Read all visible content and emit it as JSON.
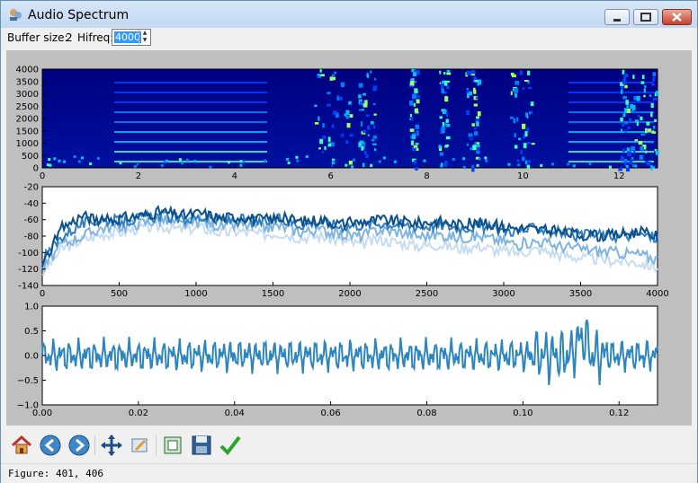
{
  "window": {
    "title": "Audio Spectrum",
    "controls": [
      "minimize",
      "maximize",
      "close"
    ]
  },
  "controls_bar": {
    "buffer_label": "Buffer size:",
    "buffer_value": "2",
    "hifreq_label": "Hifreq:",
    "hifreq_value": "4000"
  },
  "chart_data": [
    {
      "type": "heatmap",
      "title": "",
      "x_ticks": [
        "0",
        "2",
        "4",
        "6",
        "8",
        "10",
        "12"
      ],
      "y_ticks": [
        "4000",
        "3500",
        "3000",
        "2500",
        "2000",
        "1500",
        "1000",
        "500",
        "0"
      ],
      "xlim": [
        0,
        12.8
      ],
      "ylim": [
        0,
        4000
      ],
      "colormap": "jet"
    },
    {
      "type": "line",
      "x_ticks": [
        "0",
        "500",
        "1000",
        "1500",
        "2000",
        "2500",
        "3000",
        "3500",
        "4000"
      ],
      "y_ticks": [
        "-20",
        "-40",
        "-60",
        "-80",
        "-100",
        "-120",
        "-140"
      ],
      "xlim": [
        0,
        4000
      ],
      "ylim": [
        -140,
        -20
      ],
      "series": [
        {
          "color": "#0b4f8c",
          "values": [
            -115,
            -70,
            -55,
            -62,
            -58,
            -55,
            -50,
            -55,
            -52,
            -58,
            -56,
            -60,
            -58,
            -62,
            -60,
            -65,
            -63,
            -60,
            -62,
            -64,
            -62,
            -66,
            -64,
            -68,
            -70,
            -72,
            -75,
            -78,
            -80,
            -78,
            -75,
            -80
          ]
        },
        {
          "color": "#2f7fbf",
          "values": [
            -110,
            -80,
            -65,
            -60,
            -62,
            -58,
            -55,
            -60,
            -57,
            -62,
            -60,
            -64,
            -60,
            -66,
            -62,
            -68,
            -66,
            -64,
            -66,
            -68,
            -66,
            -70,
            -68,
            -72,
            -74,
            -70,
            -75,
            -80,
            -78,
            -80,
            -78,
            -82
          ]
        },
        {
          "color": "#7fb3e0",
          "values": [
            -120,
            -90,
            -80,
            -70,
            -68,
            -64,
            -60,
            -66,
            -62,
            -68,
            -66,
            -70,
            -68,
            -75,
            -72,
            -78,
            -80,
            -72,
            -75,
            -80,
            -78,
            -82,
            -80,
            -85,
            -90,
            -86,
            -92,
            -95,
            -98,
            -100,
            -102,
            -108
          ]
        },
        {
          "color": "#c6dcf0",
          "values": [
            -125,
            -95,
            -85,
            -78,
            -75,
            -70,
            -68,
            -72,
            -70,
            -76,
            -74,
            -78,
            -76,
            -82,
            -80,
            -86,
            -90,
            -84,
            -88,
            -92,
            -90,
            -95,
            -92,
            -98,
            -100,
            -96,
            -102,
            -106,
            -108,
            -110,
            -112,
            -118
          ]
        }
      ]
    },
    {
      "type": "line",
      "x_ticks": [
        "0.00",
        "0.02",
        "0.04",
        "0.06",
        "0.08",
        "0.10",
        "0.12"
      ],
      "y_ticks": [
        "1.0",
        "0.5",
        "0.0",
        "−0.5",
        "−1.0"
      ],
      "xlim": [
        0,
        0.128
      ],
      "ylim": [
        -1,
        1
      ],
      "series": [
        {
          "color": "#2c86bd"
        }
      ]
    }
  ],
  "navbar": {
    "tools": [
      "home-icon",
      "back-icon",
      "forward-icon",
      "pan-icon",
      "zoom-icon",
      "subplots-icon",
      "save-icon",
      "check-icon"
    ]
  },
  "status": {
    "text": "Figure: 401, 406"
  }
}
